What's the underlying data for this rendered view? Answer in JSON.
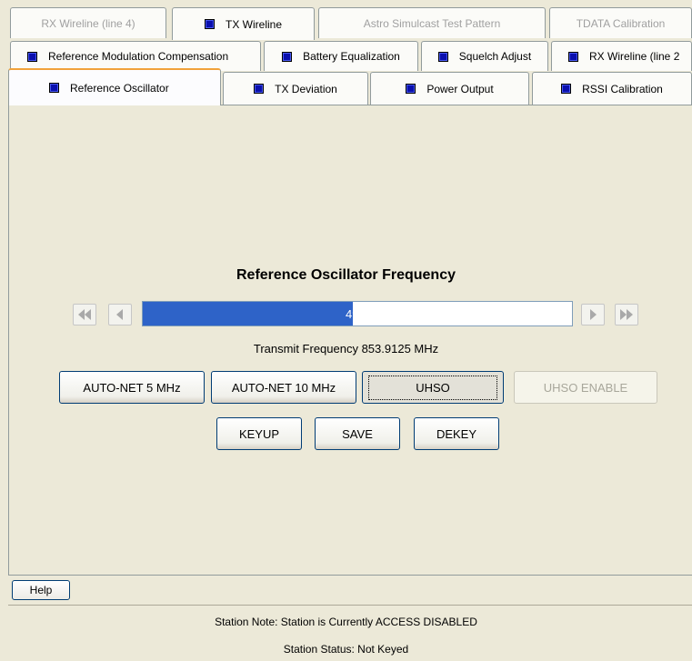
{
  "tabs_row1": [
    {
      "label": "RX Wireline (line 4)",
      "enabled": false
    },
    {
      "label": "TX Wireline",
      "enabled": true
    },
    {
      "label": "Astro Simulcast Test Pattern",
      "enabled": false
    },
    {
      "label": "TDATA Calibration",
      "enabled": false
    }
  ],
  "tabs_row2": [
    {
      "label": "Reference Modulation Compensation",
      "enabled": true
    },
    {
      "label": "Battery Equalization",
      "enabled": true
    },
    {
      "label": "Squelch Adjust",
      "enabled": true
    },
    {
      "label": "RX Wireline (line 2",
      "enabled": true
    }
  ],
  "tabs_row3": [
    {
      "label": "Reference Oscillator",
      "enabled": true,
      "selected": true
    },
    {
      "label": "TX Deviation",
      "enabled": true
    },
    {
      "label": "Power Output",
      "enabled": true
    },
    {
      "label": "RSSI Calibration",
      "enabled": true
    }
  ],
  "main": {
    "title": "Reference Oscillator Frequency",
    "progress": {
      "value": 49,
      "label": "49%"
    },
    "transmit_frequency": "Transmit Frequency  853.9125  MHz",
    "buttons_row1": {
      "auto5": "AUTO-NET 5 MHz",
      "auto10": "AUTO-NET 10 MHz",
      "uhso": "UHSO",
      "uhso_enable": "UHSO ENABLE"
    },
    "buttons_row2": {
      "keyup": "KEYUP",
      "save": "SAVE",
      "dekey": "DEKEY"
    }
  },
  "footer": {
    "help": "Help",
    "station_note": "Station Note:   Station is Currently ACCESS DISABLED",
    "station_status": "Station Status:   Not Keyed"
  },
  "icons": {
    "tab_indicator": "blue-square-icon",
    "first": "double-left-arrow-icon",
    "prev": "left-arrow-icon",
    "next": "right-arrow-icon",
    "last": "double-right-arrow-icon"
  },
  "colors": {
    "window_bg": "#ece9d8",
    "progress_fill": "#2e63c8",
    "tab_indicator": "#0a0fae",
    "selected_tab_accent": "#f1a23a"
  }
}
